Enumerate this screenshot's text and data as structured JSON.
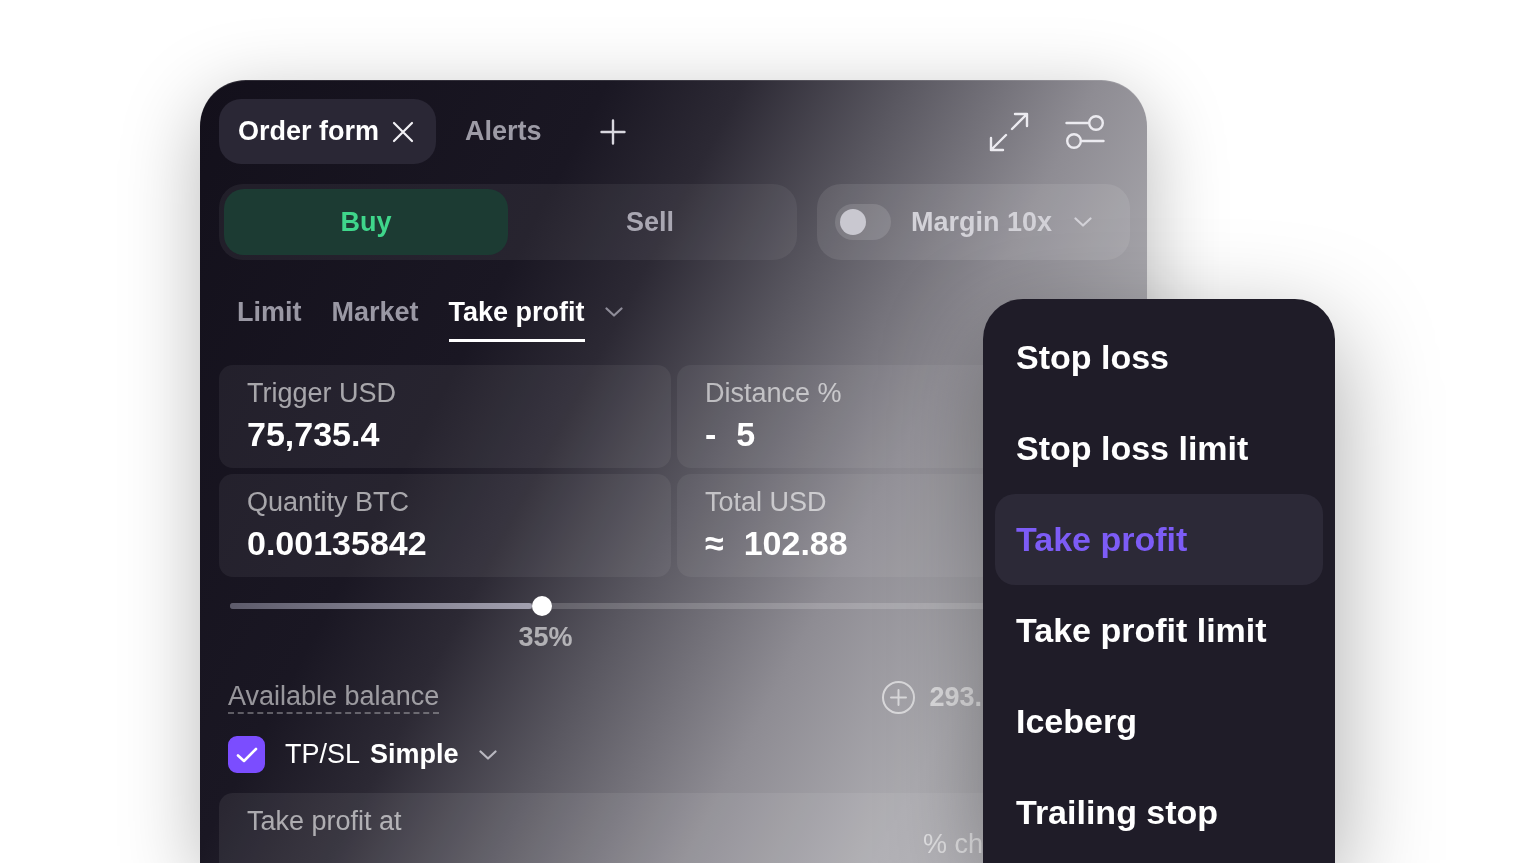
{
  "tabs": [
    {
      "label": "Order form",
      "selected": true
    },
    {
      "label": "Alerts",
      "selected": false
    }
  ],
  "sides": [
    {
      "label": "Buy",
      "kind": "buy",
      "selected": true
    },
    {
      "label": "Sell",
      "kind": "sell",
      "selected": false
    }
  ],
  "margin": {
    "on": false,
    "label": "Margin 10x"
  },
  "order_types": [
    {
      "label": "Limit",
      "selected": false
    },
    {
      "label": "Market",
      "selected": false
    },
    {
      "label": "Take profit",
      "selected": true
    }
  ],
  "order_type_menu": {
    "expanded": true,
    "items": [
      {
        "label": "Stop loss",
        "selected": false
      },
      {
        "label": "Stop loss limit",
        "selected": false
      },
      {
        "label": "Take profit",
        "selected": true
      },
      {
        "label": "Take profit limit",
        "selected": false
      },
      {
        "label": "Iceberg",
        "selected": false
      },
      {
        "label": "Trailing stop",
        "selected": false
      }
    ]
  },
  "fields": [
    {
      "label": "Trigger USD",
      "value": "75,735.4"
    },
    {
      "label": "Distance %",
      "prefix": "-",
      "value": "5"
    },
    {
      "label": "Quantity BTC",
      "value": "0.00135842"
    },
    {
      "label": "Total USD",
      "prefix": "≈",
      "value": "102.88"
    }
  ],
  "slider": {
    "level": 0.35,
    "reading": "35%"
  },
  "balance": {
    "label": "Available balance",
    "amount": "293."
  },
  "tp_sl": {
    "checked": true,
    "label": "TP/SL",
    "mode": "Simple"
  },
  "take_profit": {
    "label": "Take profit at",
    "column_2_label": "% ch"
  }
}
